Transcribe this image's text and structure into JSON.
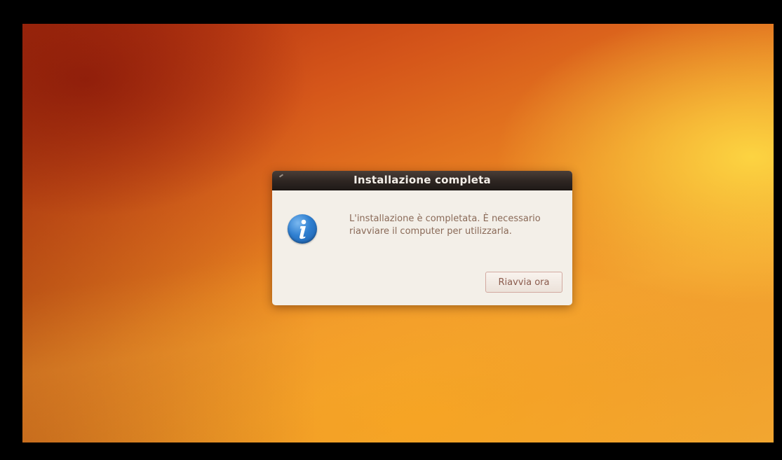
{
  "dialog": {
    "title": "Installazione completa",
    "message": "L'installazione è completata. È necessario riavviare il computer per utilizzarla.",
    "icon": "info-icon",
    "restart_label": "Riavvia ora"
  },
  "colors": {
    "titlebar": "#2e2622",
    "dialog_bg": "#f3efe8",
    "icon_blue": "#2f7fd0",
    "wallpaper_orange": "#ea8422"
  }
}
